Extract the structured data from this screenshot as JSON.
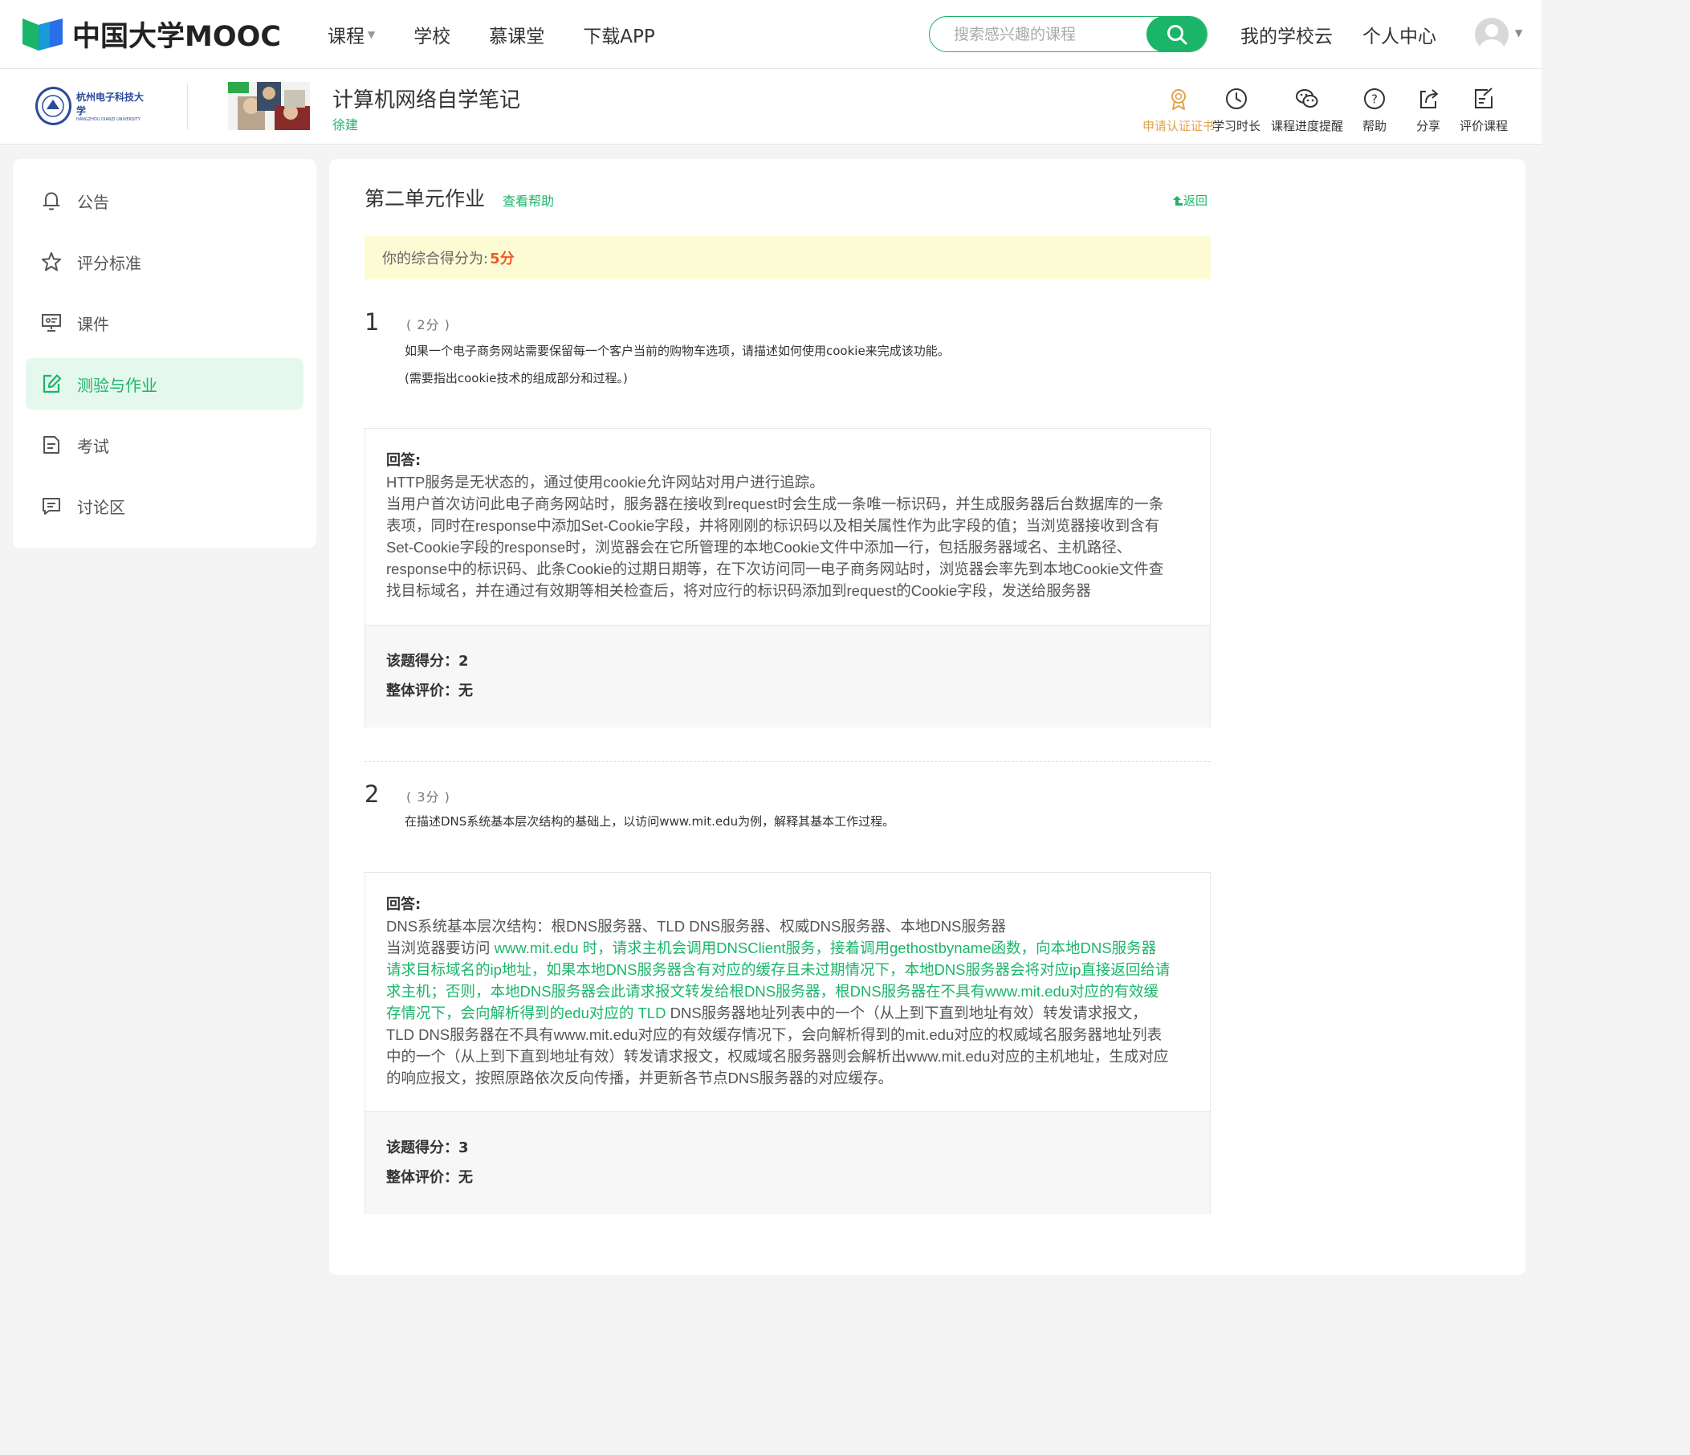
{
  "header": {
    "logo_text": "中国大学MOOC",
    "nav": [
      {
        "label": "课程",
        "has_caret": true
      },
      {
        "label": "学校"
      },
      {
        "label": "慕课堂"
      },
      {
        "label": "下载APP"
      }
    ],
    "search_placeholder": "搜索感兴趣的课程",
    "my_school_cloud": "我的学校云",
    "personal_center": "个人中心",
    "brand_color": "#1bb56a"
  },
  "course": {
    "school_name_cn": "杭州电子科技大学",
    "school_name_en": "HANGZHOU DIANZI UNIVERSITY",
    "title": "计算机网络自学笔记",
    "teacher": "徐建",
    "tools": [
      {
        "label": "申请认证证书",
        "icon": "certificate-icon",
        "accent": true
      },
      {
        "label": "学习时长",
        "icon": "clock-icon"
      },
      {
        "label": "课程进度提醒",
        "icon": "wechat-icon"
      },
      {
        "label": "帮助",
        "icon": "help-icon"
      },
      {
        "label": "分享",
        "icon": "share-icon"
      },
      {
        "label": "评价课程",
        "icon": "review-icon"
      }
    ]
  },
  "sidebar": {
    "items": [
      {
        "label": "公告",
        "icon": "bell-icon"
      },
      {
        "label": "评分标准",
        "icon": "star-icon"
      },
      {
        "label": "课件",
        "icon": "presentation-icon"
      },
      {
        "label": "测验与作业",
        "icon": "edit-icon",
        "active": true
      },
      {
        "label": "考试",
        "icon": "document-icon"
      },
      {
        "label": "讨论区",
        "icon": "chat-icon"
      }
    ]
  },
  "assignment": {
    "title": "第二单元作业",
    "help_link": "查看帮助",
    "back_link": "返回",
    "score_label": "你的综合得分为:",
    "score_value": "5分",
    "questions": [
      {
        "number": "1",
        "points": "( 2分 )",
        "text_lines": [
          "如果一个电子商务网站需要保留每一个客户当前的购物车选项，请描述如何使用cookie来完成该功能。",
          "(需要指出cookie技术的组成部分和过程。)"
        ],
        "answer_label": "回答:",
        "answer_lines": [
          "HTTP服务是无状态的，通过使用cookie允许网站对用户进行追踪。",
          "当用户首次访问此电子商务网站时，服务器在接收到request时会生成一条唯一标识码，并生成服务器后台数据库的一条",
          "表项，同时在response中添加Set-Cookie字段，并将刚刚的标识码以及相关属性作为此字段的值；当浏览器接收到含有",
          "Set-Cookie字段的response时，浏览器会在它所管理的本地Cookie文件中添加一行，包括服务器域名、主机路径、",
          "response中的标识码、此条Cookie的过期日期等，在下次访问同一电子商务网站时，浏览器会率先到本地Cookie文件查",
          "找目标域名，并在通过有效期等相关检查后，将对应行的标识码添加到request的Cookie字段，发送给服务器"
        ],
        "score_line": "该题得分：2",
        "comment_line": "整体评价：无"
      },
      {
        "number": "2",
        "points": "( 3分 )",
        "text_lines": [
          "在描述DNS系统基本层次结构的基础上，以访问www.mit.edu为例，解释其基本工作过程。"
        ],
        "answer_label": "回答:",
        "answer_line_1": "DNS系统基本层次结构：根DNS服务器、TLD DNS服务器、权威DNS服务器、本地DNS服务器",
        "answer_line_2_plain": "当浏览器要访问 ",
        "answer_line_2_green": "www.mit.edu 时，请求主机会调用DNSClient服务，接着调用gethostbyname函数，向本地DNS服务器",
        "answer_green_lines": [
          "请求目标域名的ip地址，如果本地DNS服务器含有对应的缓存且未过期情况下，本地DNS服务器会将对应ip直接返回给请",
          "求主机；否则，本地DNS服务器会此请求报文转发给根DNS服务器，根DNS服务器在不具有www.mit.edu对应的有效缓"
        ],
        "answer_line_6_green": "存情况下，会向解析得到的edu对应的 TLD ",
        "answer_line_6_plain": "DNS服务器地址列表中的一个（从上到下直到地址有效）转发请求报文，",
        "answer_tail_lines": [
          "TLD DNS服务器在不具有www.mit.edu对应的有效缓存情况下，会向解析得到的mit.edu对应的权威域名服务器地址列表",
          "中的一个（从上到下直到地址有效）转发请求报文，权威域名服务器则会解析出www.mit.edu对应的主机地址，生成对应",
          "的响应报文，按照原路依次反向传播，并更新各节点DNS服务器的对应缓存。"
        ],
        "score_line": "该题得分：3",
        "comment_line": "整体评价：无"
      }
    ]
  }
}
